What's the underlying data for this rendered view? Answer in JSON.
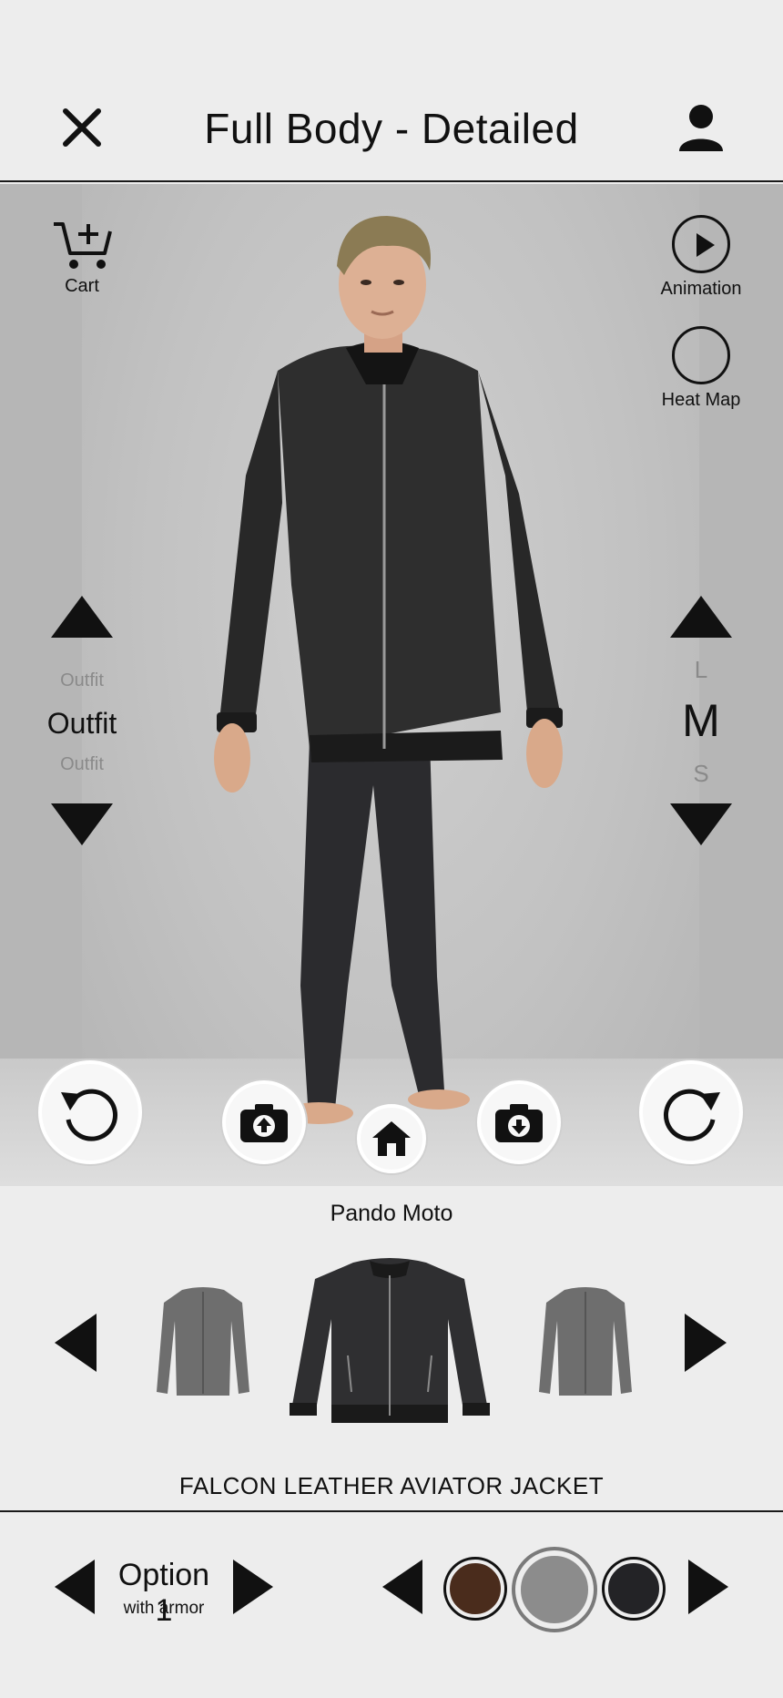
{
  "header": {
    "title": "Full Body - Detailed",
    "close_icon": "close-icon",
    "profile_icon": "user-icon"
  },
  "viewer": {
    "cart_label": "Cart",
    "animation_label": "Animation",
    "heatmap_label": "Heat Map",
    "outfit_selector": {
      "prev": "Outfit",
      "current": "Outfit",
      "next": "Outfit"
    },
    "size_selector": {
      "above": "L",
      "current": "M",
      "below": "S"
    }
  },
  "product": {
    "brand": "Pando Moto",
    "name": "FALCON LEATHER AVIATOR JACKET"
  },
  "option": {
    "title": "Option 1",
    "subtitle": "with armor"
  },
  "colors": {
    "swatches": [
      "#4a2c1c",
      "#8c8c8c",
      "#232326"
    ],
    "selected_index": 1,
    "accent": "#111111",
    "background": "#ededed"
  }
}
